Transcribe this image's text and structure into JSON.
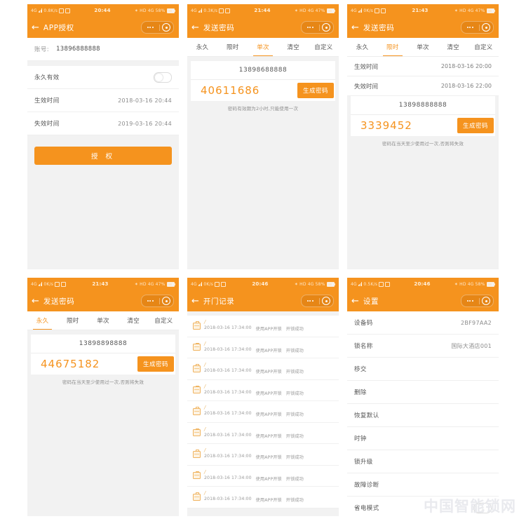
{
  "colors": {
    "brand_orange": "#f5931e",
    "page_bg": "#f2f2f2",
    "card_white": "#ffffff",
    "label_gray": "#555555",
    "value_gray": "#8c8c8c"
  },
  "watermark": "中国智能锁网",
  "statusbar_common": {
    "network": "4G",
    "hd": "HD",
    "bluetooth": "bluetooth-icon",
    "wifi": "signal-icon"
  },
  "panels": [
    {
      "id": "app-auth",
      "statusbar": {
        "speed": "0.8K/s",
        "time": "20:44",
        "battery": "58%"
      },
      "nav": {
        "back": "←",
        "title": "APP授权"
      },
      "rows": [
        {
          "label": "账号:",
          "value": "13896888888",
          "type": "account"
        },
        {
          "label": "永久有效",
          "value": "",
          "type": "toggle",
          "on": false
        },
        {
          "label": "生效时间",
          "value": "2018-03-16  20:44",
          "type": "value"
        },
        {
          "label": "失效时间",
          "value": "2019-03-16  20:44",
          "type": "value"
        }
      ],
      "button": "授  权"
    },
    {
      "id": "send-password-single",
      "statusbar": {
        "speed": "0.3K/s",
        "time": "21:44",
        "battery": "47%"
      },
      "nav": {
        "back": "←",
        "title": "发送密码"
      },
      "tabs": [
        {
          "label": "永久",
          "active": false
        },
        {
          "label": "限时",
          "active": false
        },
        {
          "label": "单次",
          "active": true
        },
        {
          "label": "清空",
          "active": false
        },
        {
          "label": "自定义",
          "active": false
        }
      ],
      "phone": "13898688888",
      "code": "40611686",
      "generate_label": "生成密码",
      "hint": "密码有效期为2小时,只能使用一次"
    },
    {
      "id": "send-password-timed",
      "statusbar": {
        "speed": "0K/s",
        "time": "21:43",
        "battery": "47%"
      },
      "nav": {
        "back": "←",
        "title": "发送密码"
      },
      "tabs": [
        {
          "label": "永久",
          "active": false
        },
        {
          "label": "限时",
          "active": true
        },
        {
          "label": "单次",
          "active": false
        },
        {
          "label": "清空",
          "active": false
        },
        {
          "label": "自定义",
          "active": false
        }
      ],
      "time_rows": [
        {
          "label": "生效时间",
          "value": "2018-03-16 20:00"
        },
        {
          "label": "失效时间",
          "value": "2018-03-16 22:00"
        }
      ],
      "phone": "13898888888",
      "code": "3339452",
      "generate_label": "生成密码",
      "hint": "密码在当天至少使用过一次,否则将失效"
    },
    {
      "id": "send-password-permanent",
      "statusbar": {
        "speed": "0K/s",
        "time": "21:43",
        "battery": "47%"
      },
      "nav": {
        "back": "←",
        "title": "发送密码"
      },
      "tabs": [
        {
          "label": "永久",
          "active": true
        },
        {
          "label": "限时",
          "active": false
        },
        {
          "label": "单次",
          "active": false
        },
        {
          "label": "清空",
          "active": false
        },
        {
          "label": "自定义",
          "active": false
        }
      ],
      "phone": "13898898888",
      "code": "44675182",
      "generate_label": "生成密码",
      "hint": "密码在当天至少使用过一次,否则将失效"
    },
    {
      "id": "unlock-records",
      "statusbar": {
        "speed": "0K/s",
        "time": "20:46",
        "battery": "58%"
      },
      "nav": {
        "back": "←",
        "title": "开门记录"
      },
      "records": [
        {
          "slash": "/",
          "datetime": "2018-03-16 17:34:00",
          "method": "使用APP开锁",
          "result": "开锁成功"
        },
        {
          "slash": "/",
          "datetime": "2018-03-16 17:34:00",
          "method": "使用APP开锁",
          "result": "开锁成功"
        },
        {
          "slash": "/",
          "datetime": "2018-03-16 17:34:00",
          "method": "使用APP开锁",
          "result": "开锁成功"
        },
        {
          "slash": "/",
          "datetime": "2018-03-16 17:34:00",
          "method": "使用APP开锁",
          "result": "开锁成功"
        },
        {
          "slash": "/",
          "datetime": "2018-03-16 17:34:00",
          "method": "使用APP开锁",
          "result": "开锁成功"
        },
        {
          "slash": "/",
          "datetime": "2018-03-16 17:34:00",
          "method": "使用APP开锁",
          "result": "开锁成功"
        },
        {
          "slash": "/",
          "datetime": "2018-03-16 17:34:00",
          "method": "使用APP开锁",
          "result": "开锁成功"
        },
        {
          "slash": "/",
          "datetime": "2018-03-16 17:34:00",
          "method": "使用APP开锁",
          "result": "开锁成功"
        },
        {
          "slash": "/",
          "datetime": "2018-03-16 17:34:00",
          "method": "使用APP开锁",
          "result": "开锁成功"
        }
      ]
    },
    {
      "id": "settings",
      "statusbar": {
        "speed": "0.5K/s",
        "time": "20:46",
        "battery": "58%"
      },
      "nav": {
        "back": "←",
        "title": "设置"
      },
      "rows": [
        {
          "label": "设备码",
          "value": "2BF97AA2",
          "type": "value"
        },
        {
          "label": "锁名称",
          "value": "国际大酒店001",
          "type": "value"
        },
        {
          "label": "移交",
          "value": "",
          "type": "value"
        },
        {
          "label": "删除",
          "value": "",
          "type": "value"
        },
        {
          "label": "恢复默认",
          "value": "",
          "type": "value"
        },
        {
          "label": "时钟",
          "value": "",
          "type": "value"
        },
        {
          "label": "锁升级",
          "value": "",
          "type": "value"
        },
        {
          "label": "故障诊断",
          "value": "",
          "type": "value"
        },
        {
          "label": "省电模式",
          "value": "",
          "type": "toggle",
          "on": false
        }
      ]
    }
  ]
}
